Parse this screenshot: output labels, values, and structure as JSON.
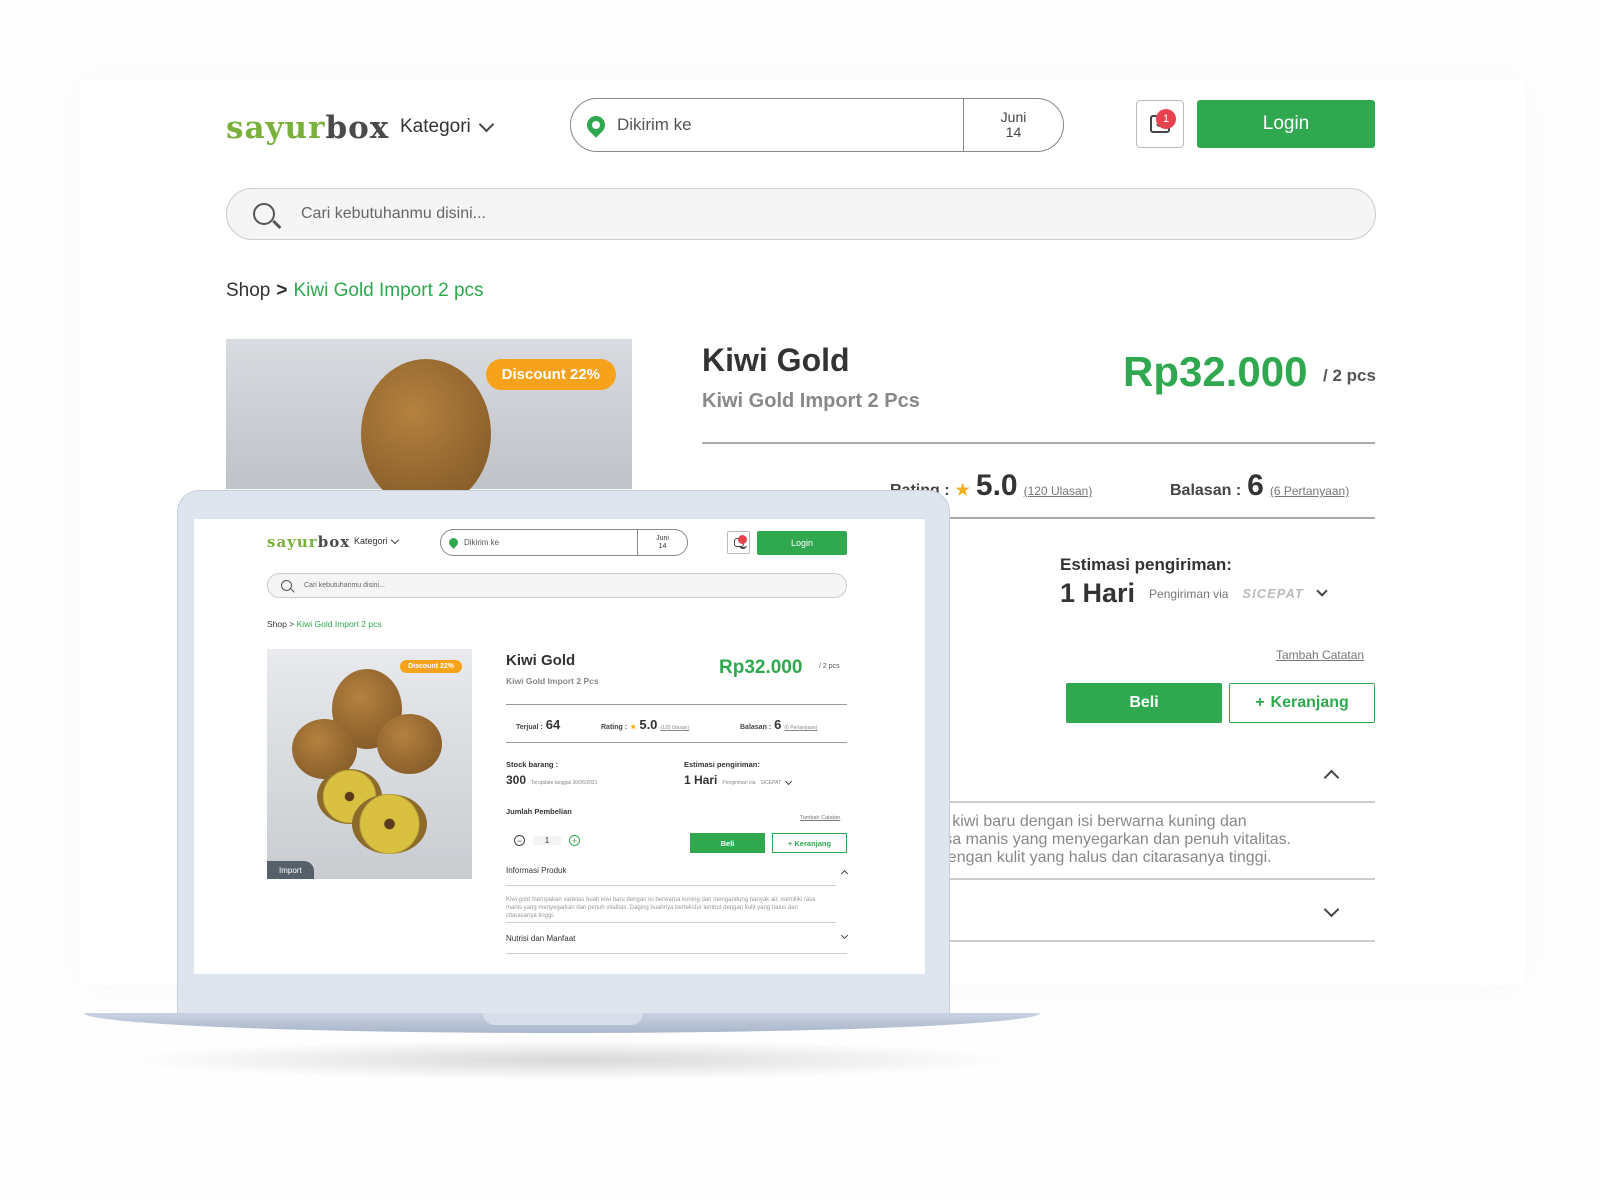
{
  "brand": {
    "logo_part1": "sayur",
    "logo_part2": "box",
    "green": "#2fa84f",
    "orange": "#f7a21b"
  },
  "header": {
    "kategori": "Kategori",
    "location_placeholder": "Dikirim ke",
    "date_month": "Juni",
    "date_day": "14",
    "cart_count": "1",
    "login": "Login",
    "search_placeholder": "Cari kebutuhanmu disini..."
  },
  "breadcrumb": {
    "root": "Shop",
    "separator": ">",
    "current": "Kiwi Gold Import 2 pcs"
  },
  "product": {
    "discount": "Discount 22%",
    "tag": "Import",
    "title": "Kiwi Gold",
    "subtitle": "Kiwi Gold Import 2 Pcs",
    "price": "Rp32.000",
    "unit": "/ 2 pcs",
    "sold_label": "Terjual :",
    "sold_value": "64",
    "rating_label": "Rating :",
    "rating_value": "5.0",
    "rating_reviews": "(120 Ulasan)",
    "replies_label": "Balasan :",
    "replies_value": "6",
    "replies_questions": "(6 Pertanyaan)",
    "stock_label": "Stock barang :",
    "stock_value": "300",
    "stock_updated": "Terupdate tanggal 30/06/2021",
    "estimate_label": "Estimasi pengiriman:",
    "estimate_value": "1 Hari",
    "shipping_via": "Pengiriman via",
    "courier": "SICEPAT",
    "add_note": "Tambah Catatan",
    "qty_label": "Jumlah Pembelian",
    "qty_value": "1",
    "buy": "Beli",
    "add_cart": "Keranjang",
    "info_title": "Informasi Produk",
    "description": "Kiwi gold merupakan varietas buah kiwi baru dengan isi berwarna kuning dan mengandung banyak air, memiliki rasa manis yang menyegarkan dan penuh vitalitas. Daging buahnya bertekstur lembut dengan kulit yang halus dan citarasanya tinggi.",
    "desc_partial_1": "ah kiwi baru dengan isi berwarna kuning dan",
    "desc_partial_2": "rasa manis yang menyegarkan dan penuh vitalitas.",
    "desc_partial_3": "t dengan kulit yang halus dan citarasanya tinggi.",
    "nutrition_title": "Nutrisi dan Manfaat"
  }
}
